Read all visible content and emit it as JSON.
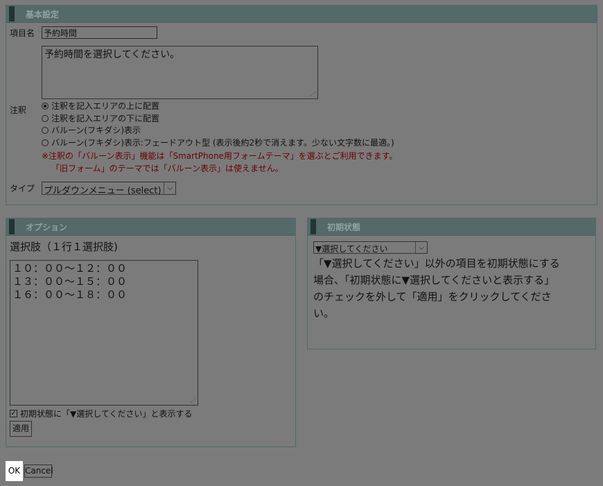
{
  "basic": {
    "header": "基本設定",
    "item_name_label": "項目名",
    "item_name_value": "予約時間",
    "note_label": "注釈",
    "note_text": "予約時間を選択してください。",
    "radio_options": [
      "注釈を記入エリアの上に配置",
      "注釈を記入エリアの下に配置",
      "バルーン(フキダシ)表示",
      "バルーン(フキダシ)表示:フェードアウト型 (表示後約2秒で消えます。少ない文字数に最適。)"
    ],
    "warning_line1": "※注釈の「バルーン表示」機能は「SmartPhone用フォームテーマ」を選ぶとご利用できます。",
    "warning_line2": "「旧フォーム」のテーマでは「バルーン表示」は使えません。",
    "type_label": "タイプ",
    "type_value": "プルダウンメニュー (select)"
  },
  "options": {
    "header": "オプション",
    "choices_label": "選択肢（１行１選択肢)",
    "choices": [
      "１０：００～１２：００",
      "１３：００～１５：００",
      "１６：００～１８：００"
    ],
    "checkbox_label": "初期状態に「▼選択してください」と表示する",
    "apply_label": "適用"
  },
  "initial": {
    "header": "初期状態",
    "select_value": "▼選択してください",
    "help_line1": "「▼選択してください」以外の項目を初期状態にする",
    "help_line2": "場合、「初期状態に▼選択してくださいと表示する」",
    "help_line3": "のチェックを外して「適用」をクリックしてくださ",
    "help_line4": "い。"
  },
  "footer": {
    "ok_label": "OK",
    "cancel_label": "Cancel"
  }
}
